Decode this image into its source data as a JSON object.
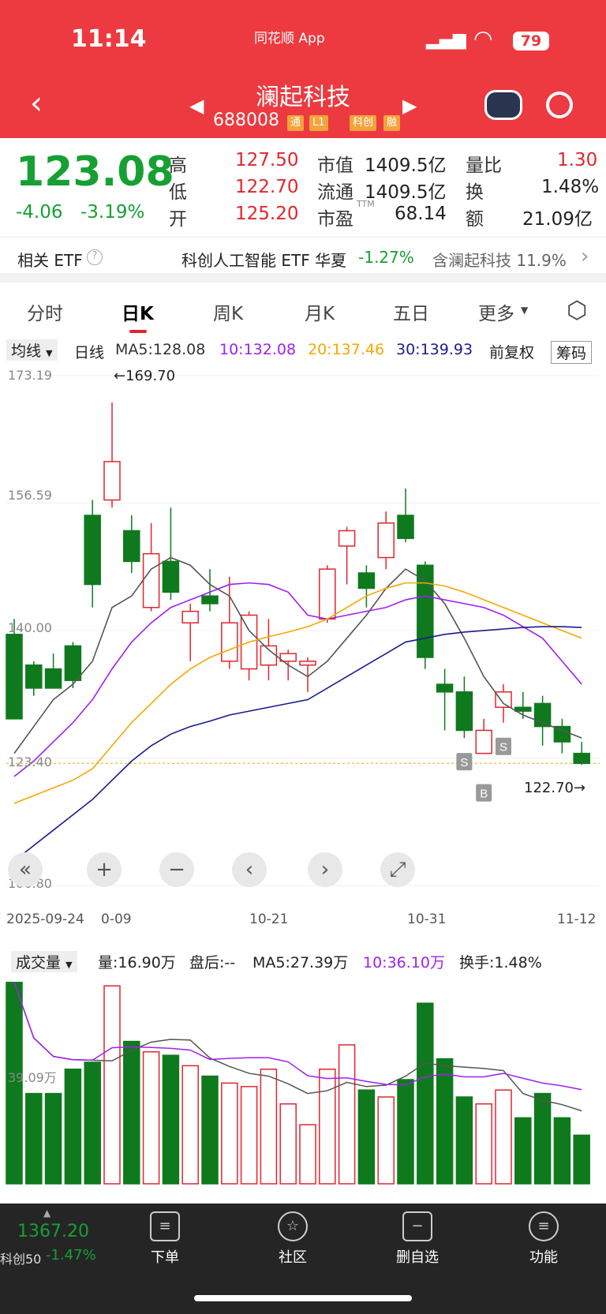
{
  "status": {
    "time": "11:14",
    "app": "同花顺 App",
    "battery": "79"
  },
  "header": {
    "title": "澜起科技",
    "code": "688008",
    "tags": [
      "通",
      "L1",
      "科创",
      "融"
    ]
  },
  "quote": {
    "price": "123.08",
    "change": "-4.06",
    "change_pct": "-3.19%",
    "high_label": "高",
    "high": "127.50",
    "low_label": "低",
    "low": "122.70",
    "open_label": "开",
    "open": "125.20",
    "mcap_label": "市值",
    "mcap": "1409.5亿",
    "float_label": "流通",
    "float": "1409.5亿",
    "pe_label": "市盈",
    "pe_sup": "TTM",
    "pe": "68.14",
    "vr_label": "量比",
    "vr": "1.30",
    "turnover_label": "换",
    "turnover": "1.48%",
    "amount_label": "额",
    "amount": "21.09亿"
  },
  "etf": {
    "label": "相关 ETF",
    "name": "科创人工智能 ETF 华夏",
    "change": "-1.27%",
    "hold": "含澜起科技 11.9%"
  },
  "tabs": [
    "分时",
    "日K",
    "周K",
    "月K",
    "五日",
    "更多"
  ],
  "legend": {
    "ma_select": "均线",
    "period": "日线",
    "ma5": "MA5:128.08",
    "ma10": "10:132.08",
    "ma20": "20:137.46",
    "ma30": "30:139.93",
    "adjust": "前复权",
    "chip": "筹码"
  },
  "chart_data": {
    "type": "candlestick",
    "y_ticks": [
      "173.19",
      "156.59",
      "140.00",
      "123.40",
      "106.80"
    ],
    "ylim": [
      106.8,
      173.19
    ],
    "max_note": "←169.70",
    "min_note": "122.70→",
    "x_labels": [
      "2025-09-24",
      "0-09",
      "10-21",
      "10-31",
      "11-12"
    ],
    "candles": [
      [
        139.5,
        128.5,
        141.5,
        128.5
      ],
      [
        135.5,
        132.5,
        136,
        131.5
      ],
      [
        135,
        132.5,
        137,
        132.5
      ],
      [
        138,
        133.5,
        138.5,
        132.5
      ],
      [
        155,
        146,
        157,
        143
      ],
      [
        157,
        162,
        169.7,
        156
      ],
      [
        153,
        149,
        155,
        147.5
      ],
      [
        143,
        150,
        154,
        142.5
      ],
      [
        149,
        145,
        156,
        144
      ],
      [
        141,
        142.5,
        143.5,
        136
      ],
      [
        144.5,
        143.5,
        148,
        142.5
      ],
      [
        136,
        141,
        147,
        135
      ],
      [
        135,
        142,
        142.5,
        133.5
      ],
      [
        135.5,
        138,
        141.5,
        133.5
      ],
      [
        136,
        137,
        137.5,
        133.5
      ],
      [
        135.5,
        136,
        136.5,
        132
      ],
      [
        141.5,
        148,
        148.5,
        141
      ],
      [
        151,
        153,
        153.5,
        146
      ],
      [
        147.5,
        145.5,
        148.5,
        143
      ],
      [
        149.5,
        154,
        155.5,
        148
      ],
      [
        155,
        152,
        158.5,
        151.5
      ],
      [
        148.5,
        136.5,
        149,
        135
      ],
      [
        133,
        132,
        135,
        127
      ],
      [
        132,
        127,
        134,
        126
      ],
      [
        124,
        127,
        128.5,
        124
      ],
      [
        130,
        132,
        133,
        128
      ],
      [
        130,
        129.5,
        132,
        128.5
      ],
      [
        130.5,
        127.5,
        131.5,
        125
      ],
      [
        127.5,
        125.5,
        128.5,
        124
      ],
      [
        124,
        122.7,
        125.5,
        122.5
      ]
    ],
    "ma5": [
      124,
      127.5,
      131,
      133,
      136,
      143,
      144.5,
      148,
      149.5,
      148.5,
      146,
      144.5,
      140,
      137.5,
      135.5,
      134,
      136,
      139,
      142,
      145.5,
      148,
      146.5,
      143.5,
      139,
      134,
      130.5,
      129,
      128,
      127,
      126
    ],
    "ma10": [
      121,
      123,
      125.5,
      128,
      131,
      135,
      138.5,
      141,
      143,
      144,
      145,
      146,
      146.2,
      146,
      145,
      142,
      141.5,
      142,
      142.5,
      143,
      144,
      144.5,
      144,
      143.5,
      143,
      142,
      140.5,
      139,
      136,
      133
    ],
    "ma20": [
      117.5,
      118.5,
      119.5,
      120.5,
      122,
      125,
      128,
      130.5,
      133,
      135,
      136.5,
      137.5,
      138.5,
      139.2,
      139.8,
      140.5,
      141.5,
      143,
      144.5,
      145.5,
      146.2,
      146.2,
      145.8,
      145,
      144,
      143,
      142,
      141,
      140,
      139
    ],
    "ma30": [
      110,
      112,
      114,
      116,
      118,
      120.5,
      123,
      125,
      126.5,
      127.5,
      128.2,
      129,
      129.5,
      130,
      130.5,
      131,
      132.5,
      134,
      135.5,
      137,
      138.5,
      139,
      139.5,
      139.8,
      140,
      140.2,
      140.4,
      140.5,
      140.5,
      140.4
    ],
    "signals": [
      {
        "label": "S",
        "i": 23
      },
      {
        "label": "B",
        "i": 24
      },
      {
        "label": "S",
        "i": 25
      }
    ]
  },
  "volume": {
    "label": "成交量",
    "vol": "量:16.90万",
    "after": "盘后:--",
    "ma5": "MA5:27.39万",
    "ma10": "10:36.10万",
    "turnover": "换手:1.48%",
    "tick": "39.09万",
    "values": [
      58,
      26,
      26,
      33,
      35,
      57,
      41,
      38,
      37,
      34,
      31,
      29,
      28,
      33,
      23,
      17,
      33,
      40,
      27,
      25,
      30,
      52,
      36,
      25,
      23,
      27,
      19,
      26,
      19,
      14
    ]
  },
  "bottom": {
    "index_value": "1367.20",
    "index_name": "科创50",
    "index_change": "-1.47%",
    "items": [
      "下单",
      "社区",
      "删自选",
      "功能"
    ]
  },
  "colors": {
    "up": "#e0262d",
    "down": "#0e7a1d",
    "ma5": "#555555",
    "ma10": "#a020f0",
    "ma20": "#f5a800",
    "ma30": "#1b1b8f"
  }
}
